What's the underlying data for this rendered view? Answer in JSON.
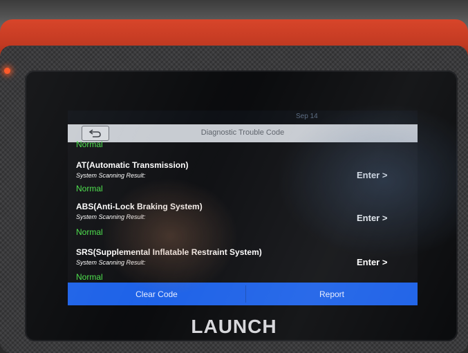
{
  "device": {
    "brand": "LAUNCH"
  },
  "status_bar": {
    "date": "Sep 14"
  },
  "header": {
    "title": "Diagnostic Trouble Code",
    "back_icon": "back-arrow-icon"
  },
  "list": {
    "partial_top_status": "Normal",
    "items": [
      {
        "title": "AT(Automatic Transmission)",
        "subtitle": "System Scanning Result:",
        "status": "Normal",
        "action": "Enter >"
      },
      {
        "title": "ABS(Anti-Lock Braking System)",
        "subtitle": "System Scanning Result:",
        "status": "Normal",
        "action": "Enter >"
      },
      {
        "title": "SRS(Supplemental Inflatable Restraint System)",
        "subtitle": "System Scanning Result:",
        "status": "Normal",
        "action": "Enter >"
      }
    ]
  },
  "footer": {
    "clear_code": "Clear Code",
    "report": "Report"
  },
  "colors": {
    "accent_blue": "#1f63e8",
    "status_green": "#4be04b",
    "device_red": "#c23a22"
  }
}
